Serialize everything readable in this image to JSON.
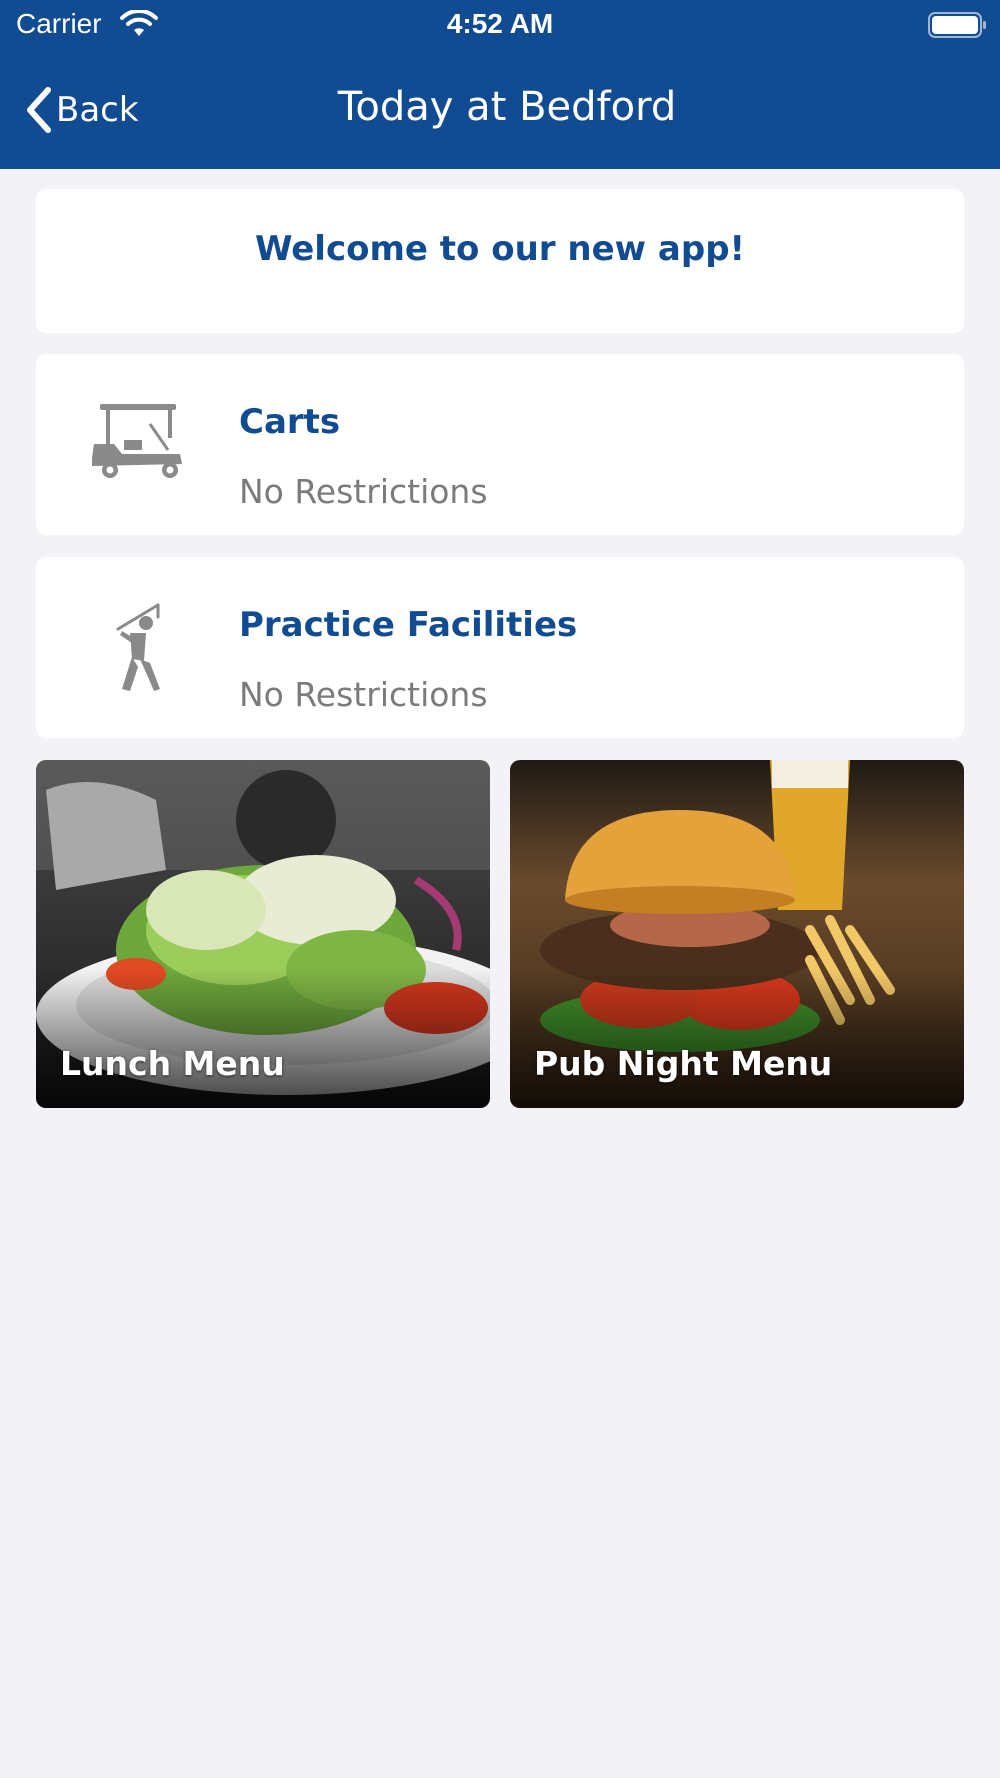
{
  "status_bar": {
    "carrier": "Carrier",
    "time": "4:52 AM",
    "icons": [
      "wifi-icon",
      "battery-icon"
    ]
  },
  "nav": {
    "back_label": "Back",
    "title": "Today at Bedford",
    "back_icon": "chevron-left-icon"
  },
  "welcome": {
    "text": "Welcome to our new app!"
  },
  "status_items": [
    {
      "title": "Carts",
      "value": "No Restrictions",
      "icon": "golf-cart-icon"
    },
    {
      "title": "Practice Facilities",
      "value": "No Restrictions",
      "icon": "golfer-icon"
    }
  ],
  "menus": [
    {
      "label": "Lunch Menu",
      "image": "salad-photo"
    },
    {
      "label": "Pub Night Menu",
      "image": "burger-photo"
    }
  ],
  "colors": {
    "header_bg": "#114b91",
    "accent_text": "#114b91",
    "secondary_text": "#7b7b7b",
    "page_bg": "#f2f2f7",
    "card_bg": "#ffffff"
  }
}
